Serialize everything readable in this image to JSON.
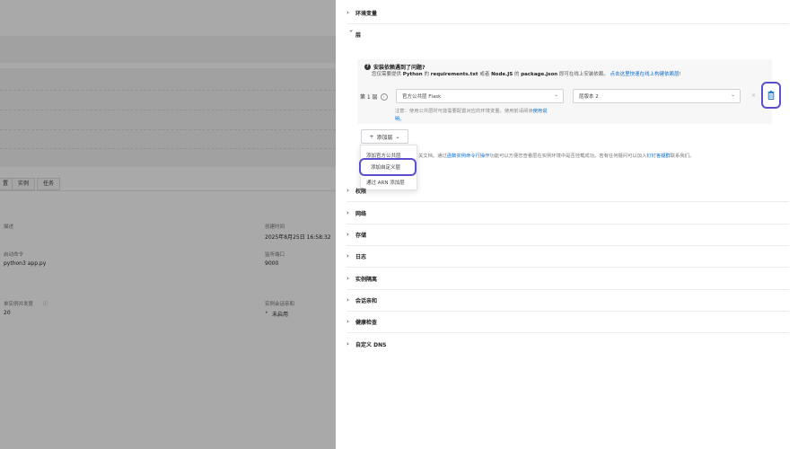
{
  "left": {
    "tabs": [
      "置",
      "实例",
      "任务"
    ],
    "fields": {
      "desc_label": "描述",
      "created_label": "创建时间",
      "created_value": "2025年8月25日 16:58:32",
      "start_cmd_label": "启动命令",
      "start_cmd_value": "python3 app.py",
      "port_label": "监听端口",
      "port_value": "9000",
      "concurrency_label": "单实例并发度",
      "concurrency_value": "20",
      "session_affinity_label": "实例会话亲和",
      "session_affinity_value": "未启用"
    }
  },
  "drawer": {
    "env_vars": "环境变量",
    "layers": "层",
    "tip_title": "安装依赖遇到了问题?",
    "tip_desc_pre": "您仅需要提供",
    "tip_python": "Python",
    "tip_mid1": "的",
    "tip_requirements": "requirements.txt",
    "tip_or": "或者",
    "tip_node": "Node.JS",
    "tip_mid2": "的",
    "tip_package": "package.json",
    "tip_post": "即可在线上安装依赖。",
    "tip_link": "点击这里快速在线上构建依赖层!",
    "layer_label": "第 1 层",
    "layer_select": "官方公共层  Flask",
    "version_select": "层版本  2",
    "note_text": "注意：使用公共层时可能需要配置对应的环境变量。使用前请阅读",
    "note_link": "使用说",
    "note_tail": "明。",
    "add_layer": "添加层",
    "menu_items": [
      "添加官方公共层",
      "添加自定义层",
      "通过 ARN 添加层"
    ],
    "more_tip_pre": "关文档。通过",
    "more_tip_link1": "函数实例命令行操作",
    "more_tip_mid": "功能可以方便您查看层在实例环境中是否挂载成功。若有任何疑问可以加入",
    "more_tip_link2": "钉钉答疑群",
    "more_tip_post": "联系我们。",
    "sections": [
      "权限",
      "网络",
      "存储",
      "日志",
      "实例隔离",
      "会话亲和",
      "健康检查",
      "自定义 DNS"
    ]
  },
  "colors": {
    "highlight": "#5a4fcf",
    "link": "#0b6bcb",
    "overlay": "#d9d9d9"
  }
}
